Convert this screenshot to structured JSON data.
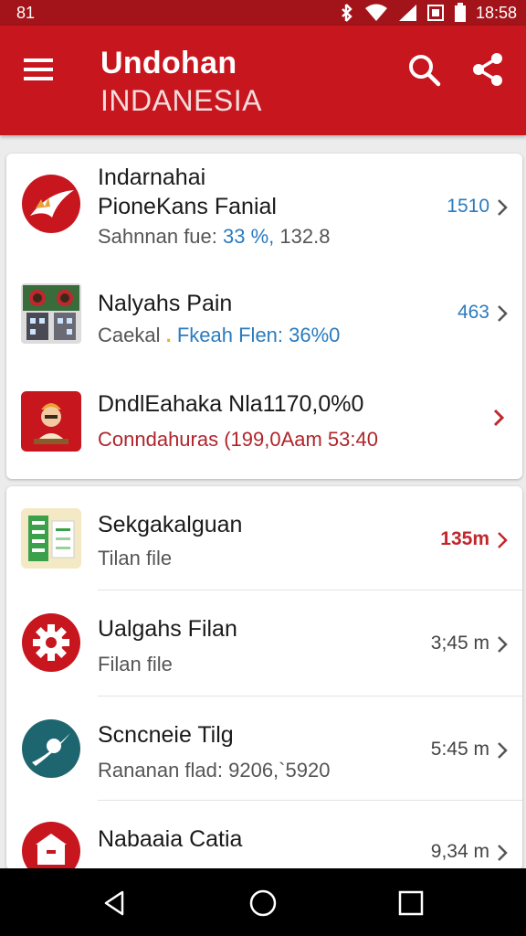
{
  "status_bar": {
    "left_text": "81",
    "time": "18:58"
  },
  "app_bar": {
    "title": "Undohan",
    "subtitle": "INDANESIA"
  },
  "colors": {
    "brand_red": "#c8161e",
    "status_red": "#a3141a",
    "link_blue": "#2a7bbf",
    "meta_red": "#c0272d"
  },
  "card1": {
    "items": [
      {
        "title_line1": "Indarnahai",
        "title_line2": "PioneKans Fanial",
        "subtitle_prefix": "Sahnnan fue:",
        "subtitle_value": "33 %,",
        "subtitle_suffix": "132.8",
        "meta": "1510",
        "icon": "red-swoosh-logo-icon"
      },
      {
        "title": "Nalyahs Pain",
        "subtitle_prefix": "Caekal",
        "subtitle_value": "Fkeah Flen: 36%0",
        "meta": "463",
        "icon": "building-thumbnail-icon"
      },
      {
        "title": "DndlEahaka Nla1170,0%0",
        "subtitle": "Conndahuras (199,0Aam 53:40",
        "meta": "",
        "icon": "warrior-figure-icon"
      }
    ]
  },
  "card2": {
    "items": [
      {
        "title": "Sekgakalguan",
        "subtitle": "Tilan file",
        "meta": "135m",
        "icon": "document-icon"
      },
      {
        "title": "Ualgahs Filan",
        "subtitle": "Filan file",
        "meta": "3;45 m",
        "icon": "gear-icon"
      },
      {
        "title": "Scncneie Tilg",
        "subtitle": "Rananan flad: 9206,`5920",
        "meta": "5:45 m",
        "icon": "planet-icon"
      },
      {
        "title": "Nabaaia Catia",
        "subtitle": "",
        "meta": "9,34 m",
        "icon": "archive-box-icon"
      }
    ]
  }
}
